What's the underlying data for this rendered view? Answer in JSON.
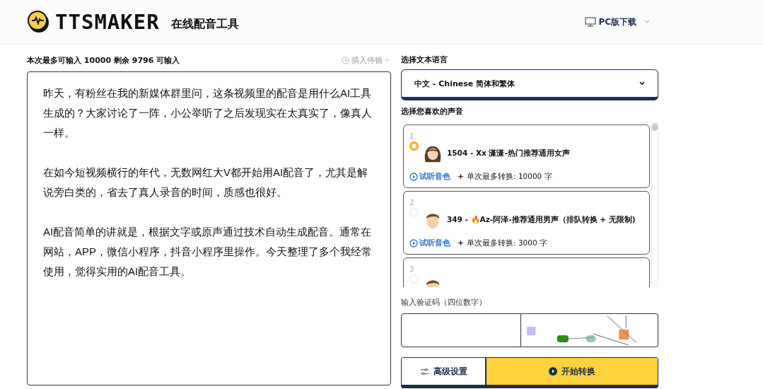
{
  "header": {
    "brand": "TTSMAKER",
    "subtitle": "在线配音工具",
    "download": "PC版下载"
  },
  "editor": {
    "limit": "本次最多可输入 10000 剩余 9796 可输入",
    "pause": "插入停顿",
    "paragraphs": [
      "昨天，有粉丝在我的新媒体群里问，这条视频里的配音是用什么AI工具生成的？大家讨论了一阵，小公举听了之后发现实在太真实了，像真人一样。",
      "在如今短视频横行的年代，无数网红大V都开始用AI配音了，尤其是解说旁白类的，省去了真人录音的时间，质感也很好。",
      "AI配音简单的讲就是，根据文字或原声通过技术自动生成配音。通常在网站，APP，微信小程序，抖音小程序里操作。今天整理了多个我经常使用，觉得实用的AI配音工具。"
    ]
  },
  "language": {
    "label": "选择文本语言",
    "value": "中文 - Chinese 简体和繁体"
  },
  "voices": {
    "label": "选择您喜欢的声音",
    "items": [
      {
        "index": "1",
        "name": "1504 - Xx 潇潇-热门推荐通用女声",
        "listen": "试听音色",
        "limit": "单次最多转换: 10000 字",
        "selected": true,
        "kind": "female"
      },
      {
        "index": "2",
        "name": "349 - 🔥Az-阿泽-推荐通用男声（排队转换 + 无限制)",
        "listen": "试听音色",
        "limit": "单次最多转换: 3000 字",
        "selected": false,
        "kind": "male"
      },
      {
        "index": "3",
        "selected": false,
        "kind": "male"
      }
    ]
  },
  "captcha": {
    "label": "输入验证码（四位数字）"
  },
  "buttons": {
    "settings": "高级设置",
    "convert": "开始转换"
  }
}
